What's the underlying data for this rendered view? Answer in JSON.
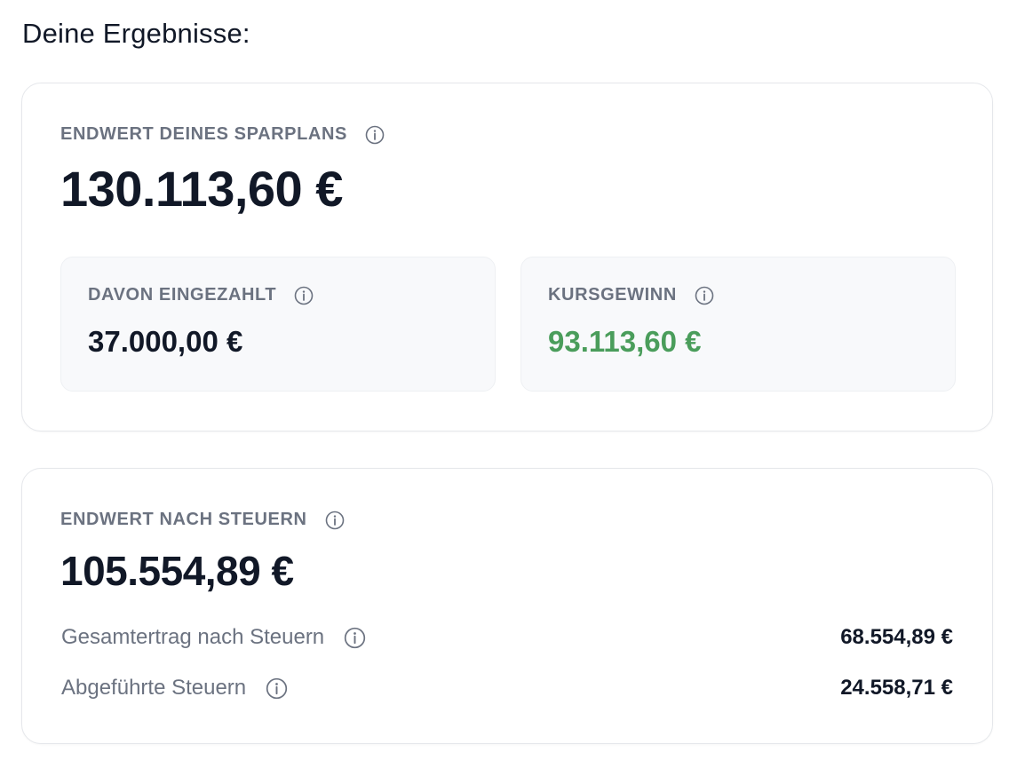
{
  "heading": "Deine Ergebnisse:",
  "card_top": {
    "label": "ENDWERT DEINES SPARPLANS",
    "value": "130.113,60 €",
    "paid_in": {
      "label": "DAVON EINGEZAHLT",
      "value": "37.000,00 €"
    },
    "price_gain": {
      "label": "KURSGEWINN",
      "value": "93.113,60 €",
      "color": "#4a9d5b"
    }
  },
  "card_bottom": {
    "label": "ENDWERT NACH STEUERN",
    "value": "105.554,89 €",
    "rows": [
      {
        "label": "Gesamtertrag nach Steuern",
        "value": "68.554,89 €"
      },
      {
        "label": "Abgeführte Steuern",
        "value": "24.558,71 €"
      }
    ]
  },
  "icons": {
    "info": "info-icon"
  }
}
